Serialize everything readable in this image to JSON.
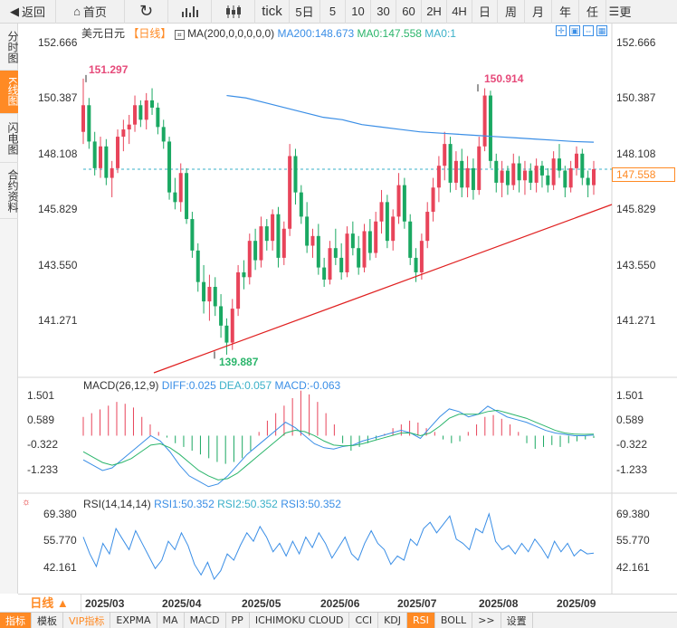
{
  "toolbar": {
    "back": "返回",
    "home": "首页",
    "periods": [
      "tick",
      "5日",
      "5",
      "10",
      "30",
      "60",
      "2H",
      "4H",
      "日",
      "周",
      "月",
      "年",
      "任"
    ],
    "more": "更"
  },
  "left_tabs": [
    "分时图",
    "K线图",
    "闪电图",
    "合约资料"
  ],
  "main_legend": {
    "symbol": "美元日元",
    "period": "【日线】",
    "ma_label": "MA(200,0,0,0,0,0)",
    "ma200": "MA200:148.673",
    "ma0a": "MA0:147.558",
    "ma0b": "MA0:1"
  },
  "price_axis": [
    "152.666",
    "150.387",
    "148.108",
    "145.829",
    "143.550",
    "141.271"
  ],
  "current_price": "147.558",
  "annotations": {
    "high1": "151.297",
    "high2": "150.914",
    "low": "139.887"
  },
  "macd_legend": {
    "label": "MACD(26,12,9)",
    "diff": "DIFF:0.025",
    "dea": "DEA:0.057",
    "macd": "MACD:-0.063"
  },
  "macd_axis": [
    "1.501",
    "0.589",
    "-0.322",
    "-1.233"
  ],
  "rsi_legend": {
    "label": "RSI(14,14,14)",
    "rsi1": "RSI1:50.352",
    "rsi2": "RSI2:50.352",
    "rsi3": "RSI3:50.352"
  },
  "rsi_axis": [
    "69.380",
    "55.770",
    "42.161"
  ],
  "period_selector": "日线 ▲",
  "dates": [
    "2025/03",
    "2025/04",
    "2025/05",
    "2025/06",
    "2025/07",
    "2025/08",
    "2025/09"
  ],
  "bottom_tabs": [
    "指标",
    "模板",
    "VIP指标",
    "EXPMA",
    "MA",
    "MACD",
    "PP",
    "ICHIMOKU CLOUD",
    "CCI",
    "KDJ",
    "RSI",
    "BOLL",
    ">>",
    "设置"
  ],
  "colors": {
    "up": "#e8445a",
    "down": "#1aa862",
    "accent": "#ff8a24",
    "ma200": "#3a8ee6",
    "trendline": "#e02020"
  },
  "chart_data": {
    "type": "candlestick",
    "title": "美元日元",
    "ylim": [
      139.0,
      153.2
    ],
    "ticks": [
      152.666,
      150.387,
      148.108,
      145.829,
      143.55,
      141.271
    ],
    "candles": [
      [
        149.1,
        151.3,
        148.6,
        150.2
      ],
      [
        150.2,
        150.5,
        148.4,
        148.7
      ],
      [
        148.7,
        149.1,
        147.3,
        147.6
      ],
      [
        147.6,
        148.9,
        147.2,
        148.5
      ],
      [
        148.5,
        148.8,
        146.9,
        147.2
      ],
      [
        147.2,
        147.9,
        146.4,
        147.6
      ],
      [
        147.6,
        149.2,
        147.4,
        148.9
      ],
      [
        148.9,
        149.6,
        148.3,
        149.2
      ],
      [
        149.2,
        149.8,
        148.6,
        149.4
      ],
      [
        149.4,
        150.6,
        149.1,
        150.2
      ],
      [
        150.2,
        150.4,
        149.3,
        149.6
      ],
      [
        149.6,
        150.7,
        149.2,
        150.4
      ],
      [
        150.4,
        150.9,
        149.8,
        150.1
      ],
      [
        150.1,
        150.3,
        149.0,
        149.3
      ],
      [
        149.3,
        149.6,
        148.4,
        148.7
      ],
      [
        148.7,
        148.9,
        146.3,
        146.6
      ],
      [
        146.6,
        147.2,
        145.9,
        146.2
      ],
      [
        146.2,
        147.8,
        145.8,
        147.4
      ],
      [
        147.4,
        147.6,
        145.3,
        145.5
      ],
      [
        145.5,
        145.8,
        143.9,
        144.2
      ],
      [
        144.2,
        144.5,
        142.5,
        142.9
      ],
      [
        142.9,
        143.6,
        141.6,
        142.1
      ],
      [
        142.1,
        143.2,
        141.3,
        142.7
      ],
      [
        142.7,
        143.1,
        141.5,
        141.9
      ],
      [
        141.9,
        142.4,
        140.6,
        141.1
      ],
      [
        141.1,
        141.4,
        139.9,
        140.4
      ],
      [
        140.4,
        142.2,
        140.1,
        141.8
      ],
      [
        141.8,
        143.6,
        141.5,
        143.3
      ],
      [
        143.3,
        143.8,
        142.6,
        143.1
      ],
      [
        143.1,
        144.9,
        142.8,
        144.6
      ],
      [
        144.6,
        145.1,
        143.4,
        143.8
      ],
      [
        143.8,
        145.6,
        143.5,
        145.2
      ],
      [
        145.2,
        145.5,
        144.2,
        144.6
      ],
      [
        144.6,
        145.9,
        144.2,
        145.7
      ],
      [
        145.7,
        146.0,
        143.5,
        143.9
      ],
      [
        143.9,
        145.4,
        143.6,
        145.1
      ],
      [
        145.1,
        148.6,
        144.8,
        148.1
      ],
      [
        148.1,
        148.4,
        146.1,
        146.6
      ],
      [
        146.6,
        146.9,
        145.3,
        145.6
      ],
      [
        145.6,
        146.2,
        144.1,
        144.4
      ],
      [
        144.4,
        145.1,
        143.9,
        144.8
      ],
      [
        144.8,
        145.3,
        143.2,
        143.5
      ],
      [
        143.5,
        143.9,
        142.7,
        143.0
      ],
      [
        143.0,
        144.6,
        142.8,
        144.3
      ],
      [
        144.3,
        145.1,
        143.6,
        143.9
      ],
      [
        143.9,
        144.5,
        143.0,
        143.3
      ],
      [
        143.3,
        145.2,
        143.1,
        144.9
      ],
      [
        144.9,
        145.4,
        144.0,
        144.3
      ],
      [
        144.3,
        144.8,
        143.2,
        143.5
      ],
      [
        143.5,
        145.3,
        143.3,
        145.0
      ],
      [
        145.0,
        145.5,
        143.8,
        144.1
      ],
      [
        144.1,
        145.8,
        143.9,
        145.4
      ],
      [
        145.4,
        146.7,
        144.9,
        146.2
      ],
      [
        146.2,
        146.5,
        144.3,
        144.6
      ],
      [
        144.6,
        145.9,
        144.2,
        145.6
      ],
      [
        145.6,
        147.4,
        145.3,
        146.9
      ],
      [
        146.9,
        147.2,
        145.1,
        145.4
      ],
      [
        145.4,
        145.7,
        143.6,
        143.9
      ],
      [
        143.9,
        144.3,
        142.9,
        143.3
      ],
      [
        143.3,
        144.9,
        143.0,
        144.6
      ],
      [
        144.6,
        146.2,
        144.3,
        145.8
      ],
      [
        145.8,
        147.2,
        145.4,
        146.8
      ],
      [
        146.8,
        148.1,
        146.2,
        147.7
      ],
      [
        147.7,
        149.1,
        147.1,
        148.6
      ],
      [
        148.6,
        148.9,
        146.6,
        147.0
      ],
      [
        147.0,
        148.3,
        146.7,
        147.9
      ],
      [
        147.9,
        148.4,
        146.4,
        146.8
      ],
      [
        146.8,
        148.1,
        146.4,
        147.6
      ],
      [
        147.6,
        148.0,
        146.3,
        146.7
      ],
      [
        146.7,
        148.9,
        146.5,
        148.5
      ],
      [
        148.5,
        150.9,
        148.3,
        150.6
      ],
      [
        150.6,
        150.8,
        147.6,
        147.9
      ],
      [
        147.9,
        148.2,
        146.6,
        147.0
      ],
      [
        147.0,
        147.9,
        146.4,
        147.5
      ],
      [
        147.5,
        147.7,
        146.5,
        146.9
      ],
      [
        146.9,
        148.2,
        146.7,
        147.8
      ],
      [
        147.8,
        148.1,
        146.6,
        147.1
      ],
      [
        147.1,
        147.9,
        146.5,
        147.5
      ],
      [
        147.5,
        147.8,
        146.7,
        147.0
      ],
      [
        147.0,
        148.0,
        146.6,
        147.7
      ],
      [
        147.7,
        147.9,
        146.8,
        147.3
      ],
      [
        147.3,
        147.6,
        146.6,
        146.9
      ],
      [
        146.9,
        148.3,
        146.7,
        148.0
      ],
      [
        148.0,
        148.6,
        147.2,
        147.5
      ],
      [
        147.5,
        147.7,
        146.4,
        146.8
      ],
      [
        146.8,
        147.9,
        146.6,
        147.6
      ],
      [
        147.6,
        148.5,
        147.3,
        148.2
      ],
      [
        148.2,
        148.4,
        146.9,
        147.2
      ],
      [
        147.2,
        147.5,
        146.4,
        146.9
      ],
      [
        146.9,
        147.9,
        146.5,
        147.558
      ]
    ],
    "ma200": [
      150.6,
      150.5,
      150.3,
      150.1,
      149.9,
      149.7,
      149.6,
      149.4,
      149.3,
      149.2,
      149.1,
      149.05,
      149.0,
      148.95,
      148.9,
      148.85,
      148.8,
      148.75,
      148.7,
      148.673
    ],
    "macd": {
      "diff": [
        -0.9,
        -1.1,
        -1.3,
        -1.2,
        -0.9,
        -0.6,
        -0.3,
        0.0,
        -0.2,
        -0.6,
        -1.1,
        -1.5,
        -1.7,
        -1.9,
        -1.8,
        -1.5,
        -1.1,
        -0.7,
        -0.4,
        -0.1,
        0.2,
        0.5,
        0.3,
        0.0,
        -0.3,
        -0.45,
        -0.5,
        -0.4,
        -0.35,
        -0.2,
        -0.1,
        0.0,
        0.1,
        0.2,
        0.1,
        -0.1,
        0.3,
        0.7,
        1.0,
        0.9,
        0.7,
        0.8,
        1.1,
        0.9,
        0.7,
        0.6,
        0.5,
        0.35,
        0.2,
        0.1,
        0.05,
        0.0,
        0.0,
        0.025
      ],
      "dea": [
        -0.6,
        -0.8,
        -1.0,
        -1.1,
        -1.0,
        -0.85,
        -0.6,
        -0.35,
        -0.3,
        -0.45,
        -0.7,
        -1.0,
        -1.3,
        -1.5,
        -1.65,
        -1.6,
        -1.4,
        -1.1,
        -0.8,
        -0.5,
        -0.2,
        0.1,
        0.2,
        0.15,
        0.0,
        -0.2,
        -0.35,
        -0.38,
        -0.37,
        -0.3,
        -0.2,
        -0.1,
        0.0,
        0.1,
        0.1,
        0.0,
        0.1,
        0.35,
        0.65,
        0.8,
        0.8,
        0.8,
        0.9,
        0.95,
        0.85,
        0.75,
        0.65,
        0.5,
        0.35,
        0.2,
        0.1,
        0.06,
        0.05,
        0.057
      ],
      "hist": [
        0.5,
        0.6,
        0.7,
        0.8,
        0.9,
        0.85,
        0.75,
        0.5,
        0.3,
        0.1,
        -0.05,
        -0.2,
        -0.3,
        -0.4,
        -0.5,
        -0.6,
        -0.7,
        -0.75,
        -0.7,
        -0.6,
        -0.4,
        0.1,
        0.4,
        0.6,
        0.8,
        1.0,
        1.2,
        1.1,
        0.9,
        0.6,
        0.3,
        -0.2,
        -0.4,
        -0.3,
        -0.2,
        -0.1,
        0.05,
        0.2,
        0.3,
        0.4,
        0.35,
        0.2,
        0.1,
        -0.1,
        -0.2,
        -0.15,
        0.1,
        0.3,
        0.5,
        0.55,
        0.45,
        0.3,
        0.1,
        -0.2,
        -0.35,
        -0.3,
        -0.25,
        -0.3,
        -0.2,
        -0.15,
        -0.1,
        -0.06
      ]
    },
    "rsi": [
      58,
      50,
      44,
      55,
      50,
      62,
      57,
      52,
      61,
      55,
      49,
      43,
      47,
      56,
      52,
      60,
      54,
      45,
      40,
      46,
      38,
      42,
      50,
      47,
      54,
      60,
      56,
      63,
      58,
      51,
      55,
      49,
      56,
      50,
      58,
      53,
      60,
      55,
      48,
      53,
      58,
      50,
      47,
      55,
      61,
      55,
      52,
      45,
      49,
      47,
      57,
      54,
      62,
      65,
      60,
      64,
      68,
      57,
      55,
      52,
      62,
      60,
      69,
      56,
      52,
      54,
      50,
      55,
      51,
      57,
      53,
      48,
      56,
      51,
      55,
      49,
      52,
      50,
      50.352
    ]
  }
}
